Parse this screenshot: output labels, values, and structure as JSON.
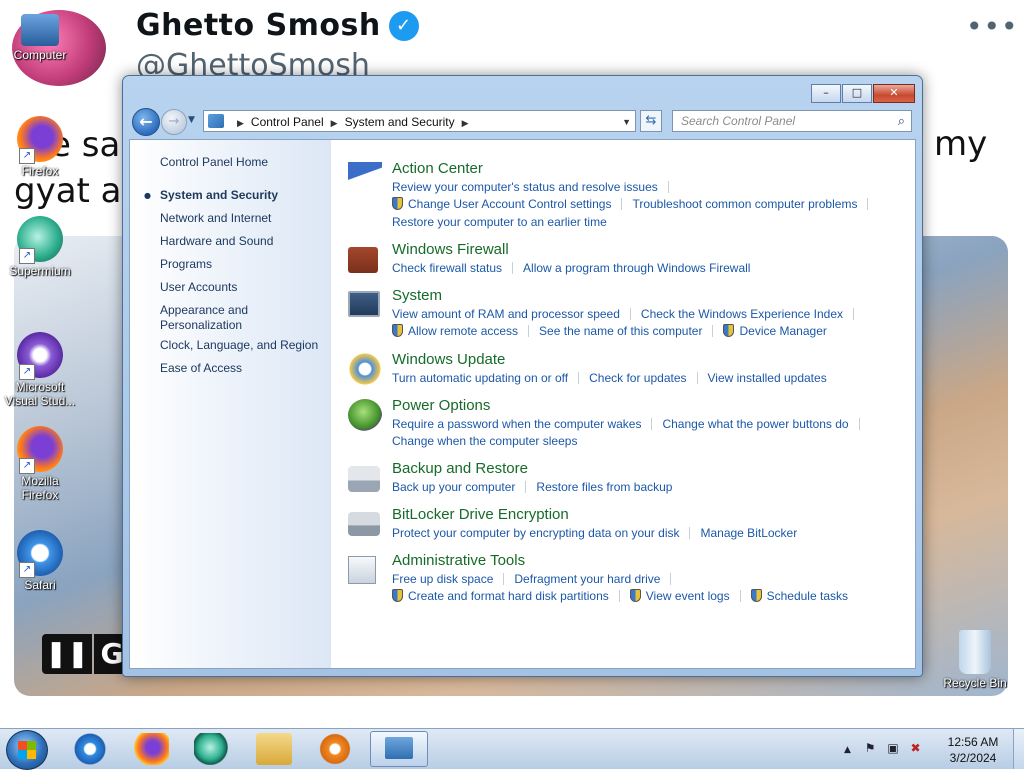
{
  "background": {
    "tweet_name": "Ghetto Smosh",
    "verified_mark": "✓",
    "tweet_handle": "@GhettoSmosh",
    "tweet_more": "•••",
    "tweet_text_left_1": "e sa",
    "tweet_text_left_2": "gyat a",
    "tweet_text_right": "my",
    "video_pause": "❚❚",
    "video_g": "G"
  },
  "desktop_icons": [
    {
      "label": "Computer",
      "icon": "computer-icon"
    },
    {
      "label": "Firefox",
      "icon": "firefox-icon"
    },
    {
      "label": "Supermium",
      "icon": "supermium-icon"
    },
    {
      "label": "Microsoft Visual Stud...",
      "icon": "visual-studio-icon"
    },
    {
      "label": "Mozilla Firefox",
      "icon": "firefox-icon"
    },
    {
      "label": "Safari",
      "icon": "safari-icon"
    },
    {
      "label": "Recycle Bin",
      "icon": "recycle-bin-icon"
    }
  ],
  "window": {
    "controls": {
      "minimize": "–",
      "maximize": "□",
      "close": "✕"
    },
    "address": {
      "root": "Control Panel",
      "current": "System and Security"
    },
    "search_placeholder": "Search Control Panel",
    "left_pane": {
      "home": "Control Panel Home",
      "items": [
        "System and Security",
        "Network and Internet",
        "Hardware and Sound",
        "Programs",
        "User Accounts",
        "Appearance and",
        "Personalization",
        "Clock, Language, and Region",
        "Ease of Access"
      ]
    },
    "categories": {
      "action_center": {
        "title": "Action Center",
        "l1a": "Review your computer's status and resolve issues",
        "l2a": "Change User Account Control settings",
        "l2b": "Troubleshoot common computer problems",
        "l3a": "Restore your computer to an earlier time"
      },
      "firewall": {
        "title": "Windows Firewall",
        "l1a": "Check firewall status",
        "l1b": "Allow a program through Windows Firewall"
      },
      "system": {
        "title": "System",
        "l1a": "View amount of RAM and processor speed",
        "l1b": "Check the Windows Experience Index",
        "l2a": "Allow remote access",
        "l2b": "See the name of this computer",
        "l2c": "Device Manager"
      },
      "update": {
        "title": "Windows Update",
        "l1a": "Turn automatic updating on or off",
        "l1b": "Check for updates",
        "l1c": "View installed updates"
      },
      "power": {
        "title": "Power Options",
        "l1a": "Require a password when the computer wakes",
        "l1b": "Change what the power buttons do",
        "l2a": "Change when the computer sleeps"
      },
      "backup": {
        "title": "Backup and Restore",
        "l1a": "Back up your computer",
        "l1b": "Restore files from backup"
      },
      "bitlocker": {
        "title": "BitLocker Drive Encryption",
        "l1a": "Protect your computer by encrypting data on your disk",
        "l1b": "Manage BitLocker"
      },
      "admin": {
        "title": "Administrative Tools",
        "l1a": "Free up disk space",
        "l1b": "Defragment your hard drive",
        "l2a": "Create and format hard disk partitions",
        "l2b": "View event logs",
        "l2c": "Schedule tasks"
      }
    }
  },
  "taskbar": {
    "pinned": [
      "start-orb",
      "internet-explorer-icon",
      "firefox-icon",
      "supermium-icon",
      "file-explorer-icon",
      "media-player-icon",
      "control-panel-icon"
    ],
    "tray_up": "▲",
    "clock_time": "12:56 AM",
    "clock_date": "3/2/2024"
  },
  "colors": {
    "link": "#1c58a8",
    "category_title": "#166b2a",
    "window_frame": "#b7d3ef"
  }
}
